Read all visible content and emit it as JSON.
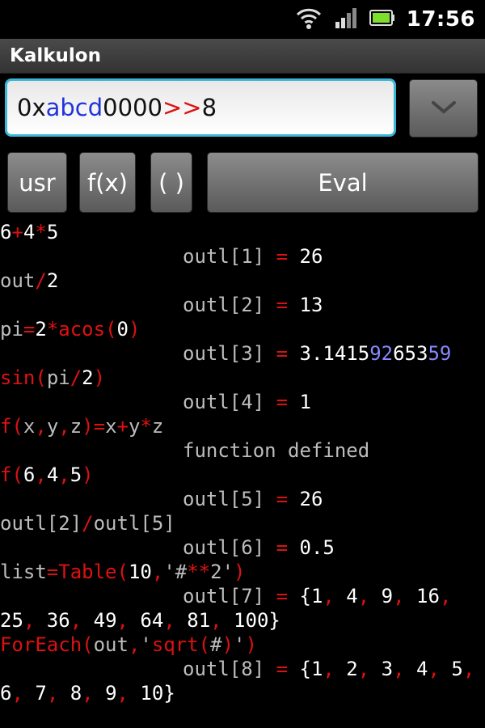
{
  "status_bar": {
    "time": "17:56",
    "icons": [
      "wifi-icon",
      "signal-icon",
      "battery-icon"
    ]
  },
  "app": {
    "title": "Kalkulon"
  },
  "input": {
    "tokens": [
      {
        "text": "0x",
        "color": "default"
      },
      {
        "text": "abcd",
        "color": "blue"
      },
      {
        "text": "0000",
        "color": "default"
      },
      {
        "text": ">>",
        "color": "red"
      },
      {
        "text": "8",
        "color": "default"
      }
    ]
  },
  "history_button": {
    "icon": "chevron-down-icon"
  },
  "buttons": {
    "usr": "usr",
    "fx": "f(x)",
    "paren": "( )",
    "eval": "Eval"
  },
  "console": {
    "lines": [
      {
        "kind": "in",
        "parts": [
          {
            "t": "6",
            "c": "num"
          },
          {
            "t": "+",
            "c": "op"
          },
          {
            "t": "4",
            "c": "num"
          },
          {
            "t": "*",
            "c": "op"
          },
          {
            "t": "5",
            "c": "num"
          }
        ]
      },
      {
        "kind": "out",
        "parts": [
          {
            "t": "outl[1] ",
            "c": "lbl"
          },
          {
            "t": "=",
            "c": "op"
          },
          {
            "t": " 26",
            "c": "num"
          }
        ]
      },
      {
        "kind": "in",
        "parts": [
          {
            "t": "out",
            "c": "lbl"
          },
          {
            "t": "/",
            "c": "op"
          },
          {
            "t": "2",
            "c": "num"
          }
        ]
      },
      {
        "kind": "out",
        "parts": [
          {
            "t": "outl[2] ",
            "c": "lbl"
          },
          {
            "t": "=",
            "c": "op"
          },
          {
            "t": " 13",
            "c": "num"
          }
        ]
      },
      {
        "kind": "in",
        "parts": [
          {
            "t": "pi",
            "c": "lbl"
          },
          {
            "t": "=",
            "c": "op"
          },
          {
            "t": "2",
            "c": "num"
          },
          {
            "t": "*",
            "c": "op"
          },
          {
            "t": "acos",
            "c": "fn"
          },
          {
            "t": "(",
            "c": "op"
          },
          {
            "t": "0",
            "c": "num"
          },
          {
            "t": ")",
            "c": "op"
          }
        ]
      },
      {
        "kind": "out",
        "parts": [
          {
            "t": "outl[3] ",
            "c": "lbl"
          },
          {
            "t": "=",
            "c": "op"
          },
          {
            "t": " 3.1415",
            "c": "num"
          },
          {
            "t": "92",
            "c": "dig-blue"
          },
          {
            "t": "653",
            "c": "num"
          },
          {
            "t": "59",
            "c": "dig-blue"
          }
        ]
      },
      {
        "kind": "in",
        "parts": [
          {
            "t": "sin",
            "c": "fn"
          },
          {
            "t": "(",
            "c": "op"
          },
          {
            "t": "pi",
            "c": "lbl"
          },
          {
            "t": "/",
            "c": "op"
          },
          {
            "t": "2",
            "c": "num"
          },
          {
            "t": ")",
            "c": "op"
          }
        ]
      },
      {
        "kind": "out",
        "parts": [
          {
            "t": "outl[4] ",
            "c": "lbl"
          },
          {
            "t": "=",
            "c": "op"
          },
          {
            "t": " 1",
            "c": "num"
          }
        ]
      },
      {
        "kind": "in",
        "parts": [
          {
            "t": "f",
            "c": "fn"
          },
          {
            "t": "(",
            "c": "op"
          },
          {
            "t": "x",
            "c": "lbl"
          },
          {
            "t": ",",
            "c": "op"
          },
          {
            "t": "y",
            "c": "lbl"
          },
          {
            "t": ",",
            "c": "op"
          },
          {
            "t": "z",
            "c": "lbl"
          },
          {
            "t": ")=",
            "c": "op"
          },
          {
            "t": "x",
            "c": "lbl"
          },
          {
            "t": "+",
            "c": "op"
          },
          {
            "t": "y",
            "c": "lbl"
          },
          {
            "t": "*",
            "c": "op"
          },
          {
            "t": "z",
            "c": "lbl"
          }
        ]
      },
      {
        "kind": "out",
        "parts": [
          {
            "t": "function defined",
            "c": "lbl"
          }
        ]
      },
      {
        "kind": "in",
        "parts": [
          {
            "t": "f",
            "c": "fn"
          },
          {
            "t": "(",
            "c": "op"
          },
          {
            "t": "6",
            "c": "num"
          },
          {
            "t": ",",
            "c": "op"
          },
          {
            "t": "4",
            "c": "num"
          },
          {
            "t": ",",
            "c": "op"
          },
          {
            "t": "5",
            "c": "num"
          },
          {
            "t": ")",
            "c": "op"
          }
        ]
      },
      {
        "kind": "out",
        "parts": [
          {
            "t": "outl[5] ",
            "c": "lbl"
          },
          {
            "t": "=",
            "c": "op"
          },
          {
            "t": " 26",
            "c": "num"
          }
        ]
      },
      {
        "kind": "in",
        "parts": [
          {
            "t": "outl[2]",
            "c": "lbl"
          },
          {
            "t": "/",
            "c": "op"
          },
          {
            "t": "outl[5]",
            "c": "lbl"
          }
        ]
      },
      {
        "kind": "out",
        "parts": [
          {
            "t": "outl[6] ",
            "c": "lbl"
          },
          {
            "t": "=",
            "c": "op"
          },
          {
            "t": " 0.5",
            "c": "num"
          }
        ]
      },
      {
        "kind": "in",
        "parts": [
          {
            "t": "list",
            "c": "lbl"
          },
          {
            "t": "=",
            "c": "op"
          },
          {
            "t": "Table",
            "c": "fn"
          },
          {
            "t": "(",
            "c": "op"
          },
          {
            "t": "10",
            "c": "num"
          },
          {
            "t": ",",
            "c": "op"
          },
          {
            "t": "'#",
            "c": "lbl"
          },
          {
            "t": "**",
            "c": "op"
          },
          {
            "t": "2'",
            "c": "lbl"
          },
          {
            "t": ")",
            "c": "op"
          }
        ]
      },
      {
        "kind": "out",
        "parts": [
          {
            "t": "outl[7] ",
            "c": "lbl"
          },
          {
            "t": "=",
            "c": "op"
          },
          {
            "t": " {1",
            "c": "num"
          },
          {
            "t": ",",
            "c": "op"
          },
          {
            "t": " 4",
            "c": "num"
          },
          {
            "t": ",",
            "c": "op"
          },
          {
            "t": " 9",
            "c": "num"
          },
          {
            "t": ",",
            "c": "op"
          },
          {
            "t": " 16",
            "c": "num"
          },
          {
            "t": ",",
            "c": "op"
          }
        ]
      },
      {
        "kind": "in",
        "parts": [
          {
            "t": "25",
            "c": "num"
          },
          {
            "t": ",",
            "c": "op"
          },
          {
            "t": " 36",
            "c": "num"
          },
          {
            "t": ",",
            "c": "op"
          },
          {
            "t": " 49",
            "c": "num"
          },
          {
            "t": ",",
            "c": "op"
          },
          {
            "t": " 64",
            "c": "num"
          },
          {
            "t": ",",
            "c": "op"
          },
          {
            "t": " 81",
            "c": "num"
          },
          {
            "t": ",",
            "c": "op"
          },
          {
            "t": " 100}",
            "c": "num"
          }
        ]
      },
      {
        "kind": "in",
        "parts": [
          {
            "t": "ForEach",
            "c": "fn"
          },
          {
            "t": "(",
            "c": "op"
          },
          {
            "t": "out",
            "c": "lbl"
          },
          {
            "t": ",",
            "c": "op"
          },
          {
            "t": "'",
            "c": "lbl"
          },
          {
            "t": "sqrt",
            "c": "fn"
          },
          {
            "t": "(",
            "c": "op"
          },
          {
            "t": "#",
            "c": "lbl"
          },
          {
            "t": ")",
            "c": "op"
          },
          {
            "t": "'",
            "c": "lbl"
          },
          {
            "t": ")",
            "c": "op"
          }
        ]
      },
      {
        "kind": "out",
        "parts": [
          {
            "t": "outl[8] ",
            "c": "lbl"
          },
          {
            "t": "=",
            "c": "op"
          },
          {
            "t": " {1",
            "c": "num"
          },
          {
            "t": ",",
            "c": "op"
          },
          {
            "t": " 2",
            "c": "num"
          },
          {
            "t": ",",
            "c": "op"
          },
          {
            "t": " 3",
            "c": "num"
          },
          {
            "t": ",",
            "c": "op"
          },
          {
            "t": " 4",
            "c": "num"
          },
          {
            "t": ",",
            "c": "op"
          },
          {
            "t": " 5",
            "c": "num"
          },
          {
            "t": ",",
            "c": "op"
          }
        ]
      },
      {
        "kind": "in",
        "parts": [
          {
            "t": "6",
            "c": "num"
          },
          {
            "t": ",",
            "c": "op"
          },
          {
            "t": " 7",
            "c": "num"
          },
          {
            "t": ",",
            "c": "op"
          },
          {
            "t": " 8",
            "c": "num"
          },
          {
            "t": ",",
            "c": "op"
          },
          {
            "t": " 9",
            "c": "num"
          },
          {
            "t": ",",
            "c": "op"
          },
          {
            "t": " 10}",
            "c": "num"
          }
        ]
      }
    ]
  }
}
